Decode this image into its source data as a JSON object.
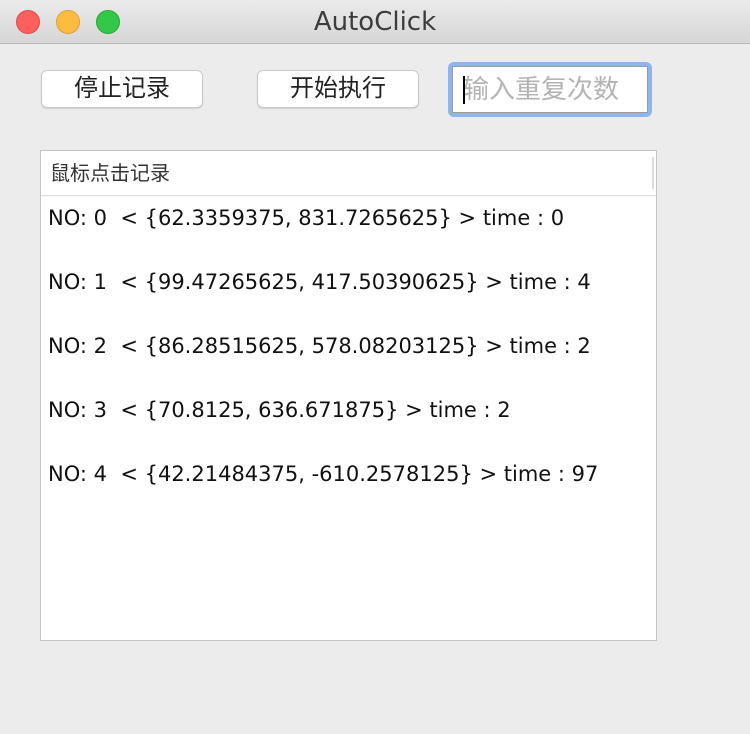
{
  "window": {
    "title": "AutoClick"
  },
  "toolbar": {
    "stop_record_label": "停止记录",
    "start_execute_label": "开始执行",
    "repeat_count": {
      "value": "",
      "placeholder": "输入重复次数"
    }
  },
  "table": {
    "header": "鼠标点击记录",
    "rows": [
      "NO: 0  < {62.3359375, 831.7265625} > time : 0",
      "NO: 1  < {99.47265625, 417.50390625} > time : 4",
      "NO: 2  < {86.28515625, 578.08203125} > time : 2",
      "NO: 3  < {70.8125, 636.671875} > time : 2",
      "NO: 4  < {42.21484375, -610.2578125} > time : 97"
    ]
  }
}
